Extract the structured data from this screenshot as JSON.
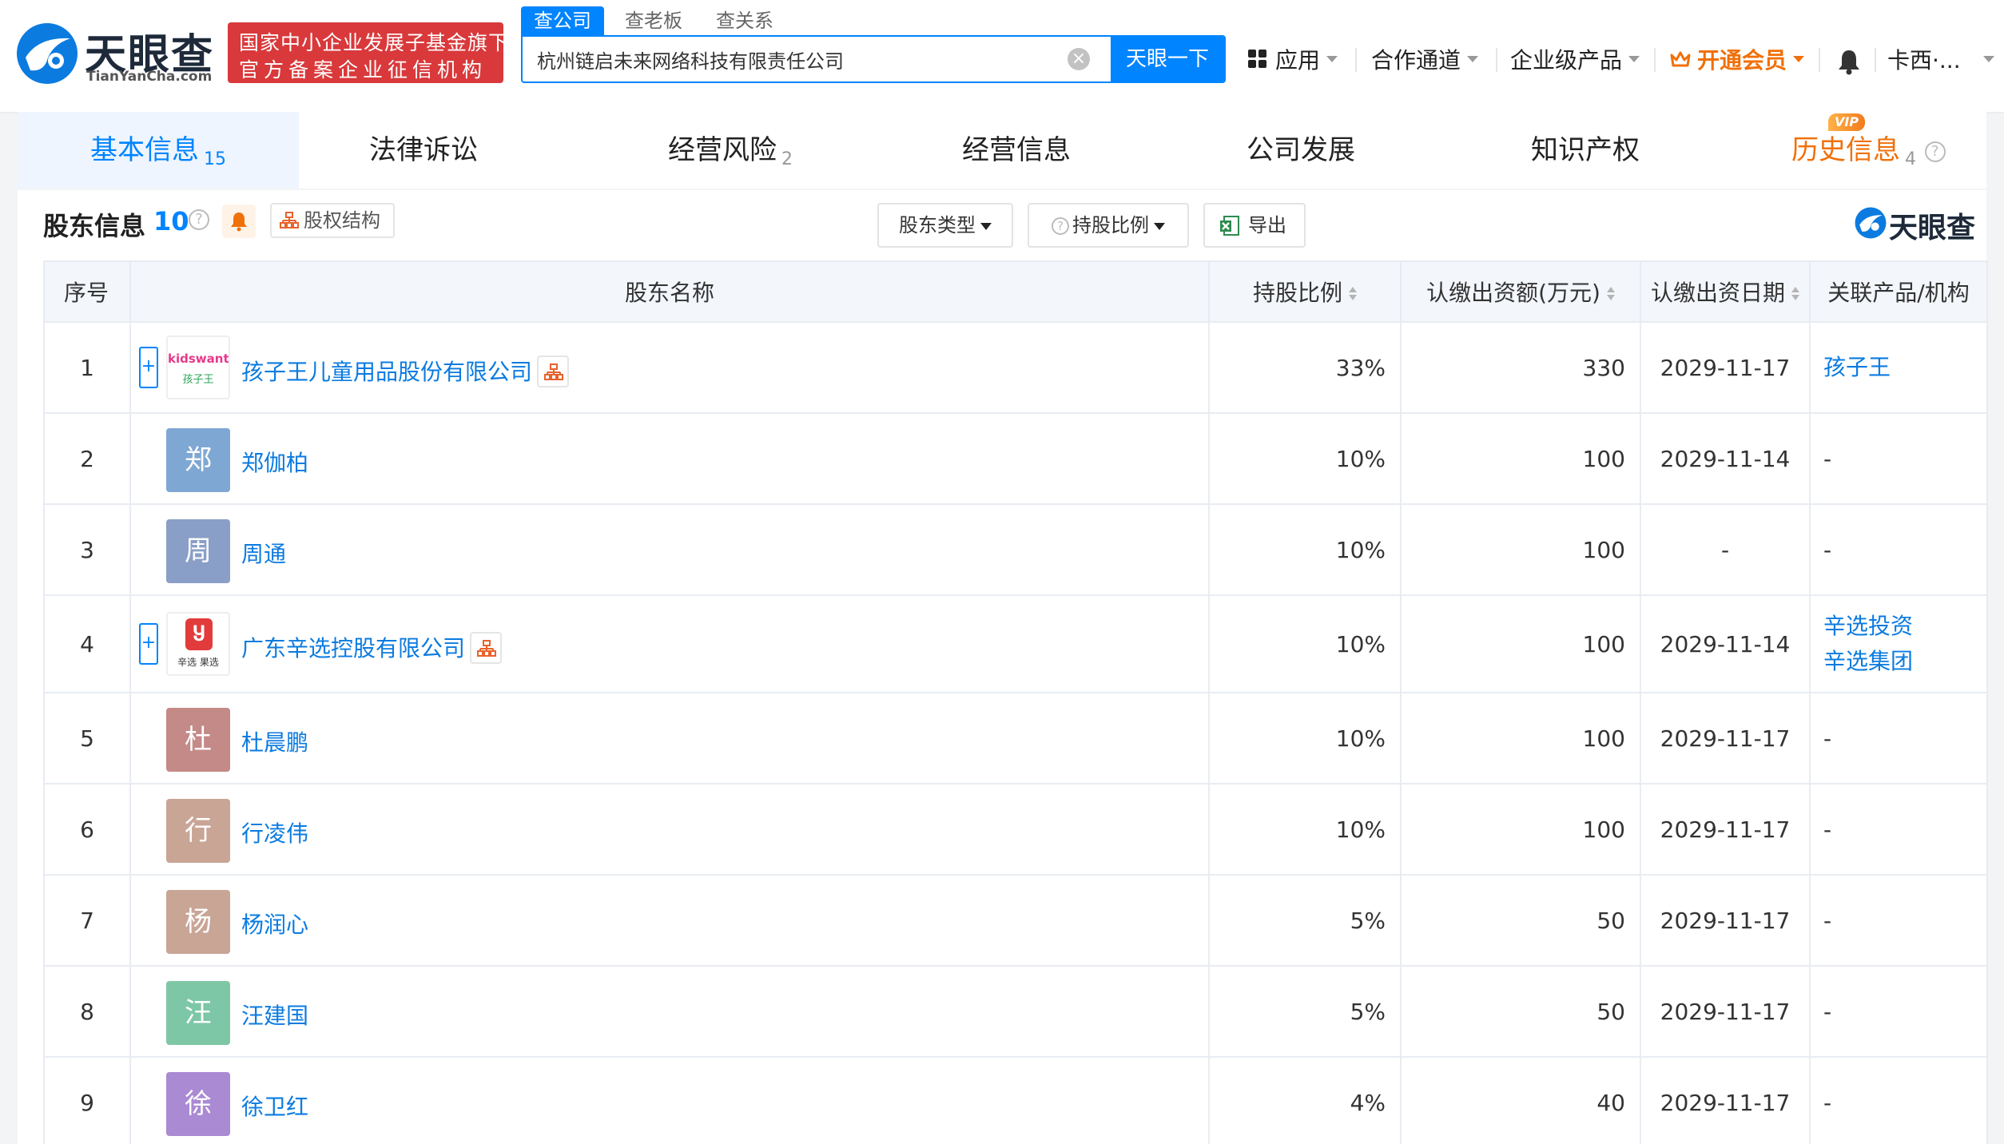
{
  "brand": {
    "name": "天眼查",
    "domain": "TianYanCha.com",
    "badge_line1": "国家中小企业发展子基金旗下",
    "badge_line2": "官方备案企业征信机构",
    "colors": {
      "primary": "#0084ff",
      "badge_red": "#d9393b",
      "vip_orange": "#f0700a"
    }
  },
  "search": {
    "tabs": [
      "查公司",
      "查老板",
      "查关系"
    ],
    "active_tab": 0,
    "value": "杭州链启未来网络科技有限责任公司",
    "button": "天眼一下",
    "clear_icon": "clear-icon"
  },
  "nav": {
    "apps": "应用",
    "channels": "合作通道",
    "enterprise": "企业级产品",
    "vip": "开通会员",
    "user": "卡西·..."
  },
  "tabs": [
    {
      "label": "基本信息",
      "count": "15"
    },
    {
      "label": "法律诉讼",
      "count": ""
    },
    {
      "label": "经营风险",
      "count": "2"
    },
    {
      "label": "经营信息",
      "count": ""
    },
    {
      "label": "公司发展",
      "count": ""
    },
    {
      "label": "知识产权",
      "count": ""
    },
    {
      "label": "历史信息",
      "count": "4",
      "badge": "VIP"
    }
  ],
  "section": {
    "title": "股东信息",
    "count": "10",
    "equity_button": "股权结构",
    "filter_type": "股东类型",
    "filter_ratio": "持股比例",
    "export": "导出",
    "watermark": "天眼查"
  },
  "table": {
    "headers": [
      "序号",
      "股东名称",
      "持股比例",
      "认缴出资额(万元)",
      "认缴出资日期",
      "关联产品/机构"
    ],
    "rows": [
      {
        "idx": "1",
        "name": "孩子王儿童用品股份有限公司",
        "kind": "company",
        "logo_text": "kidswant",
        "logo_sub": "孩子王",
        "ratio": "33%",
        "amount": "330",
        "date": "2029-11-17",
        "related": [
          "孩子王"
        ]
      },
      {
        "idx": "2",
        "name": "郑伽柏",
        "kind": "person",
        "avatar": "郑",
        "avatar_color": "#7fa7d3",
        "ratio": "10%",
        "amount": "100",
        "date": "2029-11-14",
        "related": [
          "-"
        ]
      },
      {
        "idx": "3",
        "name": "周通",
        "kind": "person",
        "avatar": "周",
        "avatar_color": "#8a9fc7",
        "ratio": "10%",
        "amount": "100",
        "date": "-",
        "related": [
          "-"
        ]
      },
      {
        "idx": "4",
        "name": "广东辛选控股有限公司",
        "kind": "company",
        "logo_text": "辛选",
        "logo_sub": "辛选 果选",
        "ratio": "10%",
        "amount": "100",
        "date": "2029-11-14",
        "related": [
          "辛选投资",
          "辛选集团"
        ]
      },
      {
        "idx": "5",
        "name": "杜晨鹏",
        "kind": "person",
        "avatar": "杜",
        "avatar_color": "#c48a88",
        "ratio": "10%",
        "amount": "100",
        "date": "2029-11-17",
        "related": [
          "-"
        ]
      },
      {
        "idx": "6",
        "name": "行凌伟",
        "kind": "person",
        "avatar": "行",
        "avatar_color": "#c9a596",
        "ratio": "10%",
        "amount": "100",
        "date": "2029-11-17",
        "related": [
          "-"
        ]
      },
      {
        "idx": "7",
        "name": "杨润心",
        "kind": "person",
        "avatar": "杨",
        "avatar_color": "#c9a596",
        "ratio": "5%",
        "amount": "50",
        "date": "2029-11-17",
        "related": [
          "-"
        ]
      },
      {
        "idx": "8",
        "name": "汪建国",
        "kind": "person",
        "avatar": "汪",
        "avatar_color": "#7ec7a6",
        "ratio": "5%",
        "amount": "50",
        "date": "2029-11-17",
        "related": [
          "-"
        ]
      },
      {
        "idx": "9",
        "name": "徐卫红",
        "kind": "person",
        "avatar": "徐",
        "avatar_color": "#a98ad3",
        "ratio": "4%",
        "amount": "40",
        "date": "2029-11-17",
        "related": [
          "-"
        ]
      }
    ]
  }
}
